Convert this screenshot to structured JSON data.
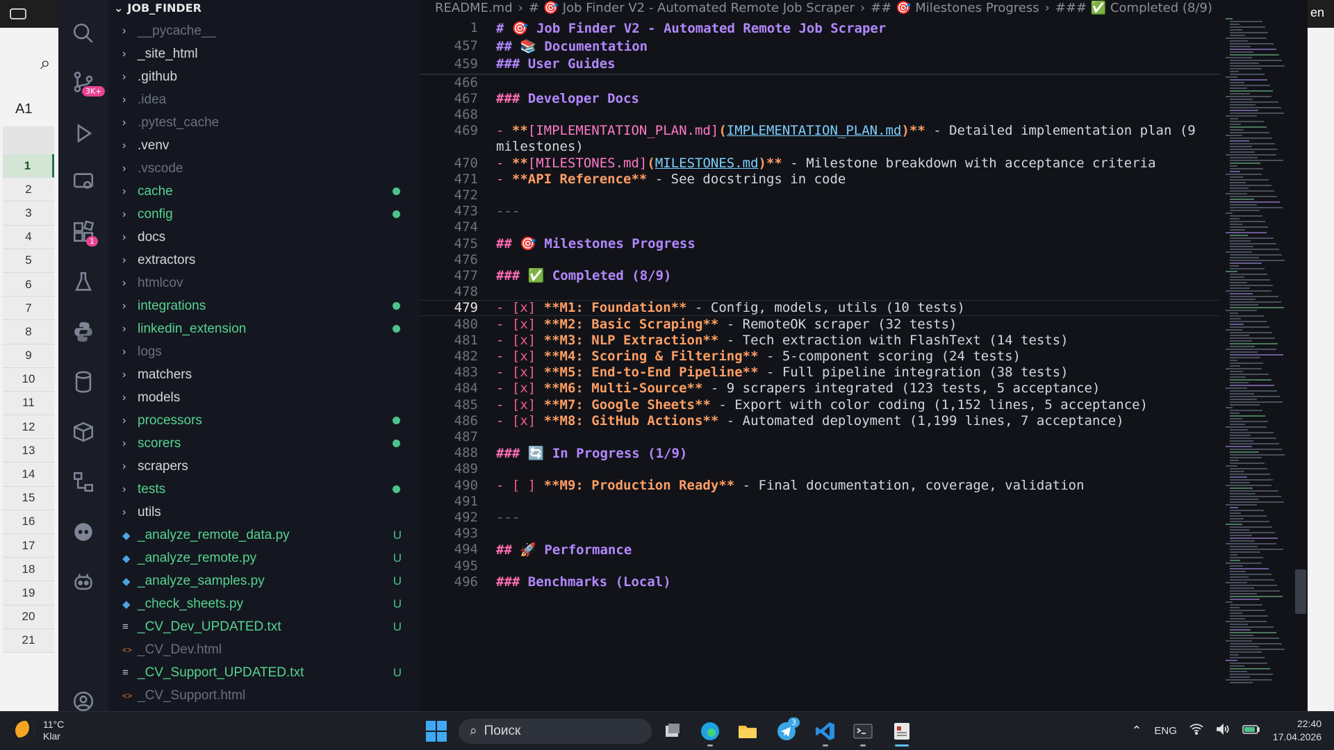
{
  "background_app": {
    "cell_ref": "A1",
    "row_numbers": [
      "1",
      "2",
      "3",
      "4",
      "5",
      "6",
      "7",
      "8",
      "9",
      "10",
      "11",
      "12",
      "13",
      "14",
      "15",
      "16",
      "17",
      "18",
      "19",
      "20",
      "21"
    ],
    "right_edge_text": "en"
  },
  "activity_bar": {
    "source_control_badge": "3K+",
    "extensions_badge": "1"
  },
  "explorer": {
    "title": "JOB_FINDER",
    "items": [
      {
        "label": "__pycache__",
        "type": "folder",
        "style": "dim",
        "status": ""
      },
      {
        "label": "_site_html",
        "type": "folder",
        "style": "normal",
        "status": ""
      },
      {
        "label": ".github",
        "type": "folder",
        "style": "normal",
        "status": ""
      },
      {
        "label": ".idea",
        "type": "folder",
        "style": "dim",
        "status": ""
      },
      {
        "label": ".pytest_cache",
        "type": "folder",
        "style": "dim",
        "status": ""
      },
      {
        "label": ".venv",
        "type": "folder",
        "style": "normal",
        "status": ""
      },
      {
        "label": ".vscode",
        "type": "folder",
        "style": "dim",
        "status": ""
      },
      {
        "label": "cache",
        "type": "folder",
        "style": "green",
        "status": "dot"
      },
      {
        "label": "config",
        "type": "folder",
        "style": "green",
        "status": "dot"
      },
      {
        "label": "docs",
        "type": "folder",
        "style": "normal",
        "status": ""
      },
      {
        "label": "extractors",
        "type": "folder",
        "style": "normal",
        "status": ""
      },
      {
        "label": "htmlcov",
        "type": "folder",
        "style": "dim",
        "status": ""
      },
      {
        "label": "integrations",
        "type": "folder",
        "style": "green",
        "status": "dot"
      },
      {
        "label": "linkedin_extension",
        "type": "folder",
        "style": "green",
        "status": "dot"
      },
      {
        "label": "logs",
        "type": "folder",
        "style": "dim",
        "status": ""
      },
      {
        "label": "matchers",
        "type": "folder",
        "style": "normal",
        "status": ""
      },
      {
        "label": "models",
        "type": "folder",
        "style": "normal",
        "status": ""
      },
      {
        "label": "processors",
        "type": "folder",
        "style": "green",
        "status": "dot"
      },
      {
        "label": "scorers",
        "type": "folder",
        "style": "green",
        "status": "dot"
      },
      {
        "label": "scrapers",
        "type": "folder",
        "style": "normal",
        "status": ""
      },
      {
        "label": "tests",
        "type": "folder",
        "style": "green",
        "status": "dot"
      },
      {
        "label": "utils",
        "type": "folder",
        "style": "normal",
        "status": ""
      },
      {
        "label": "_analyze_remote_data.py",
        "type": "py",
        "style": "green",
        "status": "U"
      },
      {
        "label": "_analyze_remote.py",
        "type": "py",
        "style": "green",
        "status": "U"
      },
      {
        "label": "_analyze_samples.py",
        "type": "py",
        "style": "green",
        "status": "U"
      },
      {
        "label": "_check_sheets.py",
        "type": "py",
        "style": "green",
        "status": "U"
      },
      {
        "label": "_CV_Dev_UPDATED.txt",
        "type": "txt",
        "style": "green",
        "status": "U"
      },
      {
        "label": "_CV_Dev.html",
        "type": "html",
        "style": "dim",
        "status": ""
      },
      {
        "label": "_CV_Support_UPDATED.txt",
        "type": "txt",
        "style": "green",
        "status": "U"
      },
      {
        "label": "_CV_Support.html",
        "type": "html",
        "style": "dim",
        "status": ""
      }
    ]
  },
  "breadcrumb": [
    "README.md",
    "# 🎯 Job Finder V2 - Automated Remote Job Scraper",
    "## 🎯 Milestones Progress",
    "### ✅ Completed (8/9)"
  ],
  "sticky": [
    {
      "n": "1",
      "text": "# 🎯 Job Finder V2 - Automated Remote Job Scraper"
    },
    {
      "n": "457",
      "text": "## 📚 Documentation"
    },
    {
      "n": "459",
      "text": "### User Guides"
    }
  ],
  "lines": [
    {
      "n": "466",
      "segs": []
    },
    {
      "n": "467",
      "segs": [
        [
          "h",
          "### "
        ],
        [
          "htxt",
          "Developer Docs"
        ]
      ]
    },
    {
      "n": "468",
      "segs": []
    },
    {
      "n": "469",
      "segs": [
        [
          "dash",
          "- "
        ],
        [
          "bold",
          "**"
        ],
        [
          "link",
          "[IMPLEMENTATION_PLAN.md]"
        ],
        [
          "bold",
          "("
        ],
        [
          "url",
          "IMPLEMENTATION_PLAN.md"
        ],
        [
          "bold",
          ")**"
        ],
        [
          "plain",
          " - Detailed implementation plan (9"
        ]
      ]
    },
    {
      "n": "",
      "segs": [
        [
          "plain",
          "milestones)"
        ]
      ]
    },
    {
      "n": "470",
      "segs": [
        [
          "dash",
          "- "
        ],
        [
          "bold",
          "**"
        ],
        [
          "link",
          "[MILESTONES.md]"
        ],
        [
          "bold",
          "("
        ],
        [
          "url",
          "MILESTONES.md"
        ],
        [
          "bold",
          ")**"
        ],
        [
          "plain",
          " - Milestone breakdown with acceptance criteria"
        ]
      ]
    },
    {
      "n": "471",
      "segs": [
        [
          "dash",
          "- "
        ],
        [
          "bold",
          "**API Reference**"
        ],
        [
          "plain",
          " - See docstrings in code"
        ]
      ]
    },
    {
      "n": "472",
      "segs": []
    },
    {
      "n": "473",
      "segs": [
        [
          "hr",
          "---"
        ]
      ]
    },
    {
      "n": "474",
      "segs": []
    },
    {
      "n": "475",
      "segs": [
        [
          "h",
          "## "
        ],
        [
          "htxt",
          "🎯 Milestones Progress"
        ]
      ]
    },
    {
      "n": "476",
      "segs": []
    },
    {
      "n": "477",
      "segs": [
        [
          "h",
          "### "
        ],
        [
          "htxt",
          "✅ Completed (8/9)"
        ]
      ]
    },
    {
      "n": "478",
      "segs": []
    },
    {
      "n": "479",
      "segs": [
        [
          "dash",
          "- "
        ],
        [
          "check",
          "[x]"
        ],
        [
          "bold",
          " **M1: Foundation**"
        ],
        [
          "plain",
          " - Config, models, utils (10 tests)"
        ]
      ]
    },
    {
      "n": "480",
      "segs": [
        [
          "dash",
          "- "
        ],
        [
          "check",
          "[x]"
        ],
        [
          "bold",
          " **M2: Basic Scraping**"
        ],
        [
          "plain",
          " - RemoteOK scraper (32 tests)"
        ]
      ]
    },
    {
      "n": "481",
      "segs": [
        [
          "dash",
          "- "
        ],
        [
          "check",
          "[x]"
        ],
        [
          "bold",
          " **M3: NLP Extraction**"
        ],
        [
          "plain",
          " - Tech extraction with FlashText (14 tests)"
        ]
      ]
    },
    {
      "n": "482",
      "segs": [
        [
          "dash",
          "- "
        ],
        [
          "check",
          "[x]"
        ],
        [
          "bold",
          " **M4: Scoring & Filtering**"
        ],
        [
          "plain",
          " - 5-component scoring (24 tests)"
        ]
      ]
    },
    {
      "n": "483",
      "segs": [
        [
          "dash",
          "- "
        ],
        [
          "check",
          "[x]"
        ],
        [
          "bold",
          " **M5: End-to-End Pipeline**"
        ],
        [
          "plain",
          " - Full pipeline integration (38 tests)"
        ]
      ]
    },
    {
      "n": "484",
      "segs": [
        [
          "dash",
          "- "
        ],
        [
          "check",
          "[x]"
        ],
        [
          "bold",
          " **M6: Multi-Source**"
        ],
        [
          "plain",
          " - 9 scrapers integrated (123 tests, 5 acceptance)"
        ]
      ]
    },
    {
      "n": "485",
      "segs": [
        [
          "dash",
          "- "
        ],
        [
          "check",
          "[x]"
        ],
        [
          "bold",
          " **M7: Google Sheets**"
        ],
        [
          "plain",
          " - Export with color coding (1,152 lines, 5 acceptance)"
        ]
      ]
    },
    {
      "n": "486",
      "segs": [
        [
          "dash",
          "- "
        ],
        [
          "check",
          "[x]"
        ],
        [
          "bold",
          " **M8: GitHub Actions**"
        ],
        [
          "plain",
          " - Automated deployment (1,199 lines, 7 acceptance)"
        ]
      ]
    },
    {
      "n": "487",
      "segs": []
    },
    {
      "n": "488",
      "segs": [
        [
          "h",
          "### "
        ],
        [
          "htxt",
          "🔄 In Progress (1/9)"
        ]
      ]
    },
    {
      "n": "489",
      "segs": []
    },
    {
      "n": "490",
      "segs": [
        [
          "dash",
          "- "
        ],
        [
          "check",
          "[ ]"
        ],
        [
          "bold",
          " **M9: Production Ready**"
        ],
        [
          "plain",
          " - Final documentation, coverage, validation"
        ]
      ]
    },
    {
      "n": "491",
      "segs": []
    },
    {
      "n": "492",
      "segs": [
        [
          "hr",
          "---"
        ]
      ]
    },
    {
      "n": "493",
      "segs": []
    },
    {
      "n": "494",
      "segs": [
        [
          "h",
          "## "
        ],
        [
          "htxt",
          "🚀 Performance"
        ]
      ]
    },
    {
      "n": "495",
      "segs": []
    },
    {
      "n": "496",
      "segs": [
        [
          "h",
          "### "
        ],
        [
          "htxt",
          "Benchmarks (Local)"
        ]
      ]
    }
  ],
  "current_line": "479",
  "taskbar": {
    "temperature": "11°C",
    "weather": "Klar",
    "search_placeholder": "Поиск",
    "telegram_badge": "3",
    "language": "ENG",
    "time": "22:40",
    "date": "17.04.2026"
  },
  "colors": {
    "heading": "#ff6fb5",
    "heading_text": "#b388ff",
    "bold": "#ff9e64",
    "link_url": "#7dcfff",
    "git_added": "#4cc38a"
  }
}
